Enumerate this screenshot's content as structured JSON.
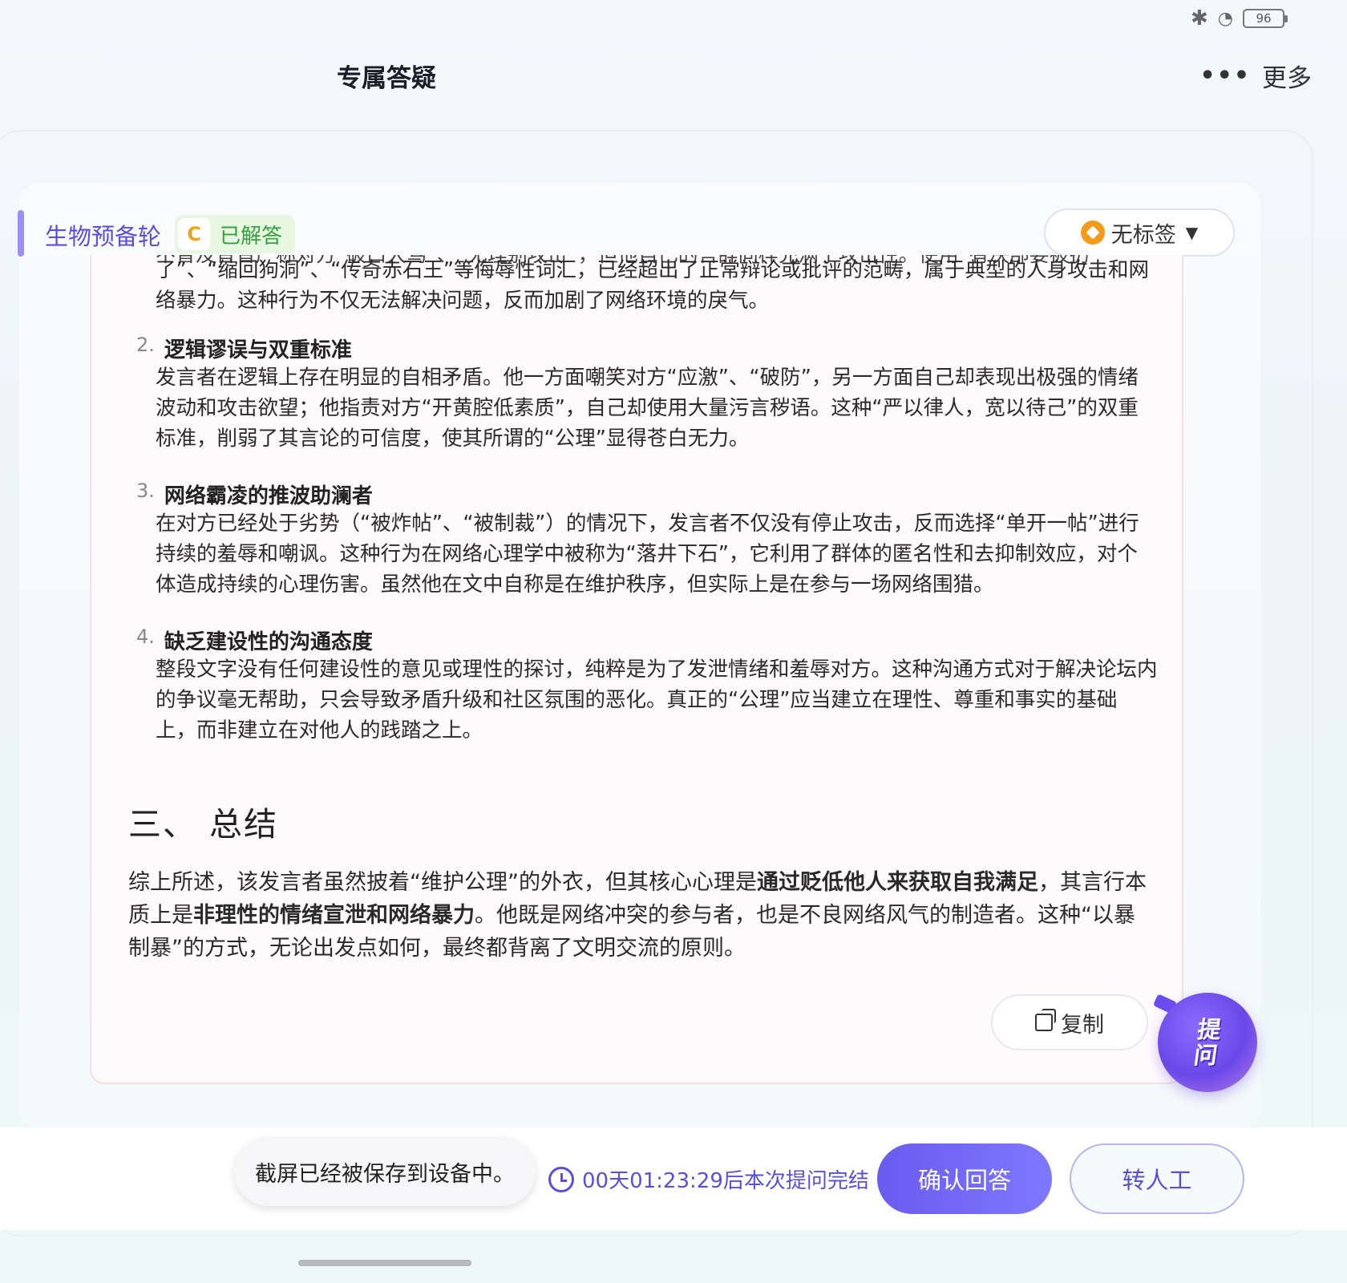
{
  "status": {
    "battery": "96"
  },
  "header": {
    "title": "专属答疑",
    "more_label": "更多"
  },
  "question": {
    "subject": "生物预备轮",
    "level_badge": "C",
    "status_label": "已解答",
    "tag_label": "无标签"
  },
  "answer": {
    "cut_line": "不昏及音音严称对方“破口大骂”、“无理别攻击”，但他自己的言辞同样充满了攻击性。使用“有决部要被扔",
    "cut_paragraph": "了”、“缩回狗洞”、“传奇赤石王”等侮辱性词汇，已经超出了正常辩论或批评的范畴，属于典型的人身攻击和网络暴力。这种行为不仅无法解决问题，反而加剧了网络环境的戾气。",
    "items": [
      {
        "num": "2.",
        "title": "逻辑谬误与双重标准",
        "body": "发言者在逻辑上存在明显的自相矛盾。他一方面嘲笑对方“应激”、“破防”，另一方面自己却表现出极强的情绪波动和攻击欲望；他指责对方“开黄腔低素质”，自己却使用大量污言秽语。这种“严以律人，宽以待己”的双重标准，削弱了其言论的可信度，使其所谓的“公理”显得苍白无力。"
      },
      {
        "num": "3.",
        "title": "网络霸凌的推波助澜者",
        "body": "在对方已经处于劣势（“被炸帖”、“被制裁”）的情况下，发言者不仅没有停止攻击，反而选择“单开一帖”进行持续的羞辱和嘲讽。这种行为在网络心理学中被称为“落井下石”，它利用了群体的匿名性和去抑制效应，对个体造成持续的心理伤害。虽然他在文中自称是在维护秩序，但实际上是在参与一场网络围猎。"
      },
      {
        "num": "4.",
        "title": "缺乏建设性的沟通态度",
        "body": "整段文字没有任何建设性的意见或理性的探讨，纯粹是为了发泄情绪和羞辱对方。这种沟通方式对于解决论坛内的争议毫无帮助，只会导致矛盾升级和社区氛围的恶化。真正的“公理”应当建立在理性、尊重和事实的基础上，而非建立在对他人的践踏之上。"
      }
    ],
    "section_title": "三、 总结",
    "summary": {
      "part1": "综上所述，该发言者虽然披着“维护公理”的外衣，但其核心心理是",
      "bold1": "通过贬低他人来获取自我满足",
      "part2": "，其言行本质上是",
      "bold2": "非理性的情绪宣泄和网络暴力",
      "part3": "。他既是网络冲突的参与者，也是不良网络风气的制造者。这种“以暴制暴”的方式，无论出发点如何，最终都背离了文明交流的原则。"
    },
    "copy_label": "复制"
  },
  "fab": {
    "label": "提问"
  },
  "footer": {
    "toast": "截屏已经被保存到设备中。",
    "countdown": "00天01:23:29后本次提问完结",
    "confirm_label": "确认回答",
    "human_label": "转人工"
  }
}
